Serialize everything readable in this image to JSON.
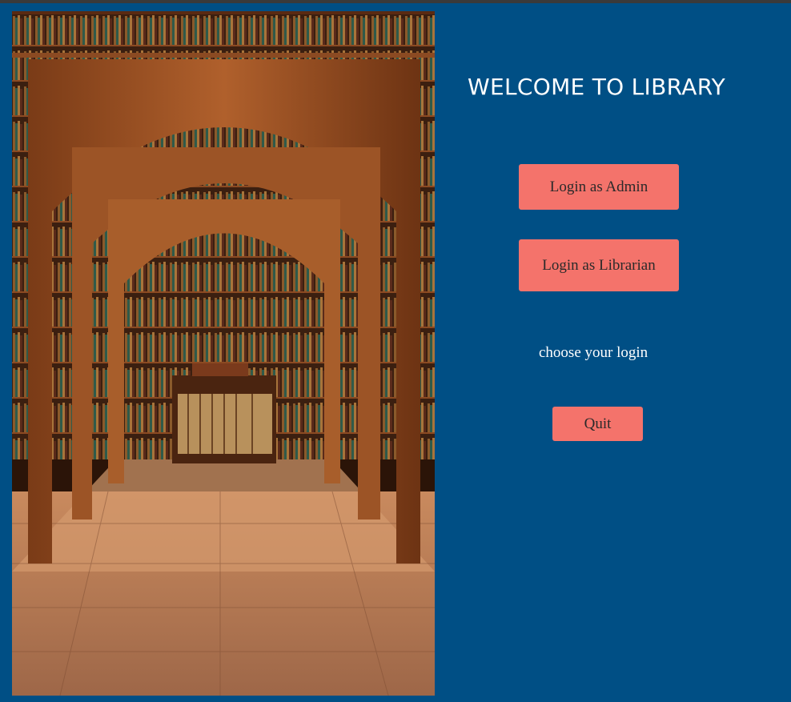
{
  "app": {
    "title": "WELCOME TO LIBRARY",
    "background_color": "#004f85",
    "accent_button_color": "#f4736b"
  },
  "image": {
    "subject": "library-interior-photo"
  },
  "buttons": {
    "admin_label": "Login as Admin",
    "librarian_label": "Login as Librarian",
    "quit_label": "Quit"
  },
  "hint_text": "choose your login"
}
